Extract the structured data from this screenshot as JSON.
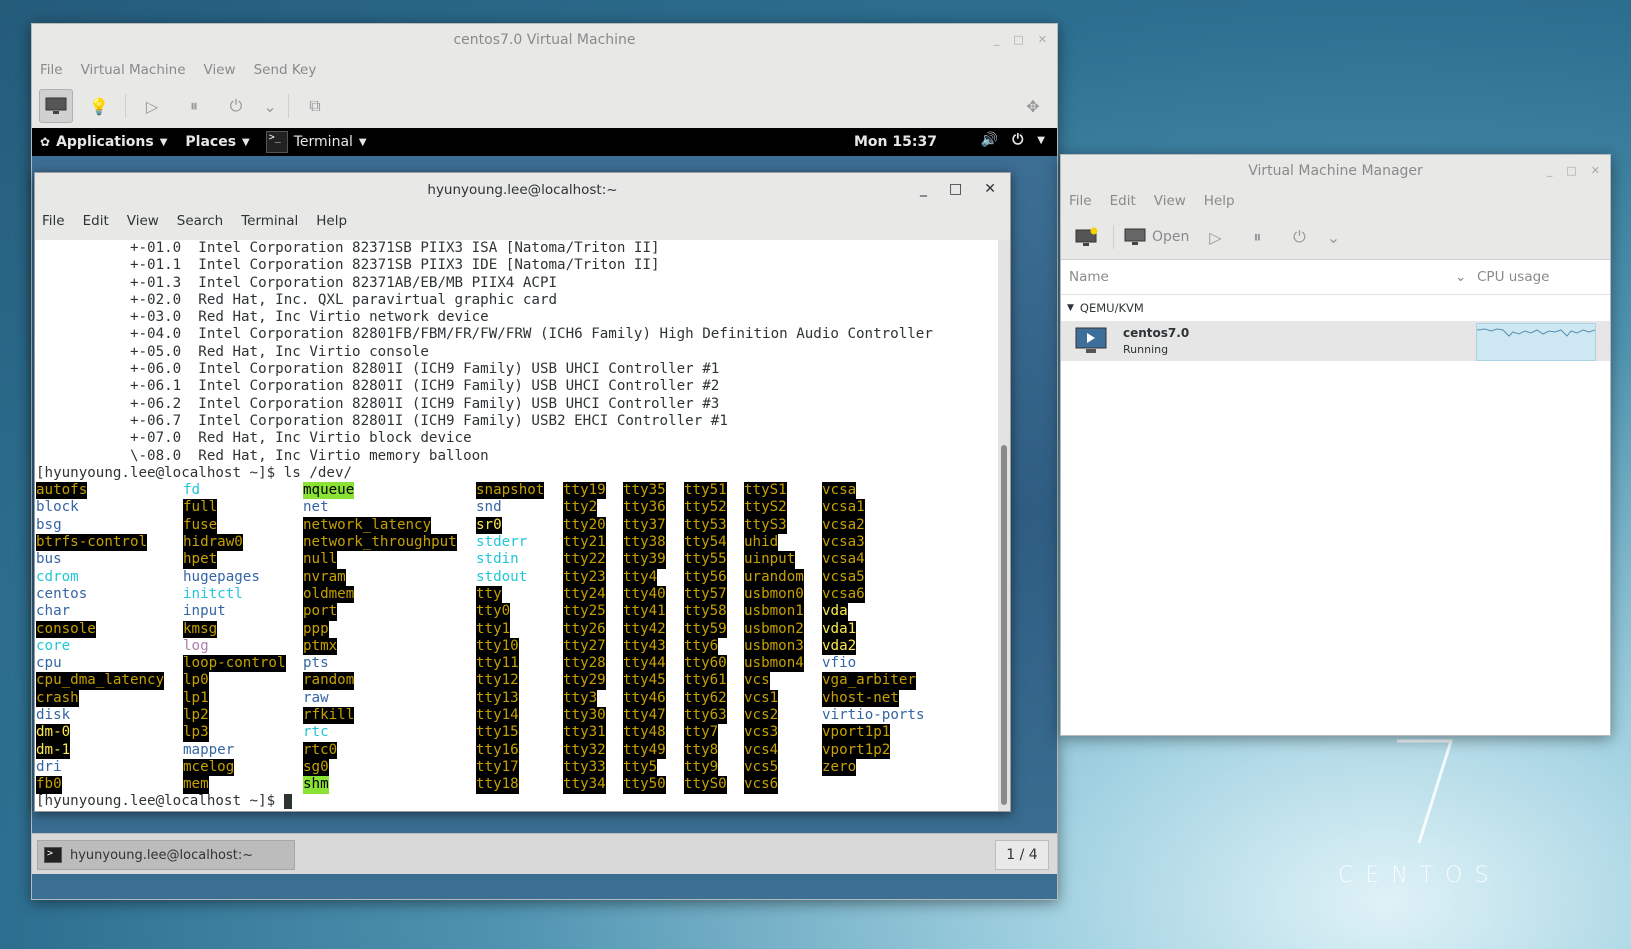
{
  "vm_viewer": {
    "title": "centos7.0 Virtual Machine",
    "menu": [
      "File",
      "Virtual Machine",
      "View",
      "Send Key"
    ]
  },
  "gnome_top_bar": {
    "applications": "Applications",
    "places": "Places",
    "terminal": "Terminal",
    "clock": "Mon 15:37"
  },
  "terminal": {
    "title": "hyunyoung.lee@localhost:~",
    "menu": [
      "File",
      "Edit",
      "View",
      "Search",
      "Terminal",
      "Help"
    ],
    "lines": [
      "           +-01.0  Intel Corporation 82371SB PIIX3 ISA [Natoma/Triton II]",
      "           +-01.1  Intel Corporation 82371SB PIIX3 IDE [Natoma/Triton II]",
      "           +-01.3  Intel Corporation 82371AB/EB/MB PIIX4 ACPI",
      "           +-02.0  Red Hat, Inc. QXL paravirtual graphic card",
      "           +-03.0  Red Hat, Inc Virtio network device",
      "           +-04.0  Intel Corporation 82801FB/FBM/FR/FW/FRW (ICH6 Family) High Definition Audio Controller",
      "           +-05.0  Red Hat, Inc Virtio console",
      "           +-06.0  Intel Corporation 82801I (ICH9 Family) USB UHCI Controller #1",
      "           +-06.1  Intel Corporation 82801I (ICH9 Family) USB UHCI Controller #2",
      "           +-06.2  Intel Corporation 82801I (ICH9 Family) USB UHCI Controller #3",
      "           +-06.7  Intel Corporation 82801I (ICH9 Family) USB2 EHCI Controller #1",
      "           +-07.0  Red Hat, Inc Virtio block device",
      "           \\-08.0  Red Hat, Inc Virtio memory balloon",
      "[hyunyoung.lee@localhost ~]$ ls /dev/"
    ],
    "prompt": "[hyunyoung.lee@localhost ~]$ ",
    "ls_columns": [
      [
        [
          "autofs",
          "dev"
        ],
        [
          "block",
          "dir"
        ],
        [
          "bsg",
          "dir"
        ],
        [
          "btrfs-control",
          "dev"
        ],
        [
          "bus",
          "dir"
        ],
        [
          "cdrom",
          "lnk"
        ],
        [
          "centos",
          "dir"
        ],
        [
          "char",
          "dir"
        ],
        [
          "console",
          "dev"
        ],
        [
          "core",
          "lnk"
        ],
        [
          "cpu",
          "dir"
        ],
        [
          "cpu_dma_latency",
          "dev"
        ],
        [
          "crash",
          "dev"
        ],
        [
          "disk",
          "dir"
        ],
        [
          "dm-0",
          "devy"
        ],
        [
          "dm-1",
          "devy"
        ],
        [
          "dri",
          "dir"
        ],
        [
          "fb0",
          "dev"
        ]
      ],
      [
        [
          "fd",
          "lnk"
        ],
        [
          "full",
          "dev"
        ],
        [
          "fuse",
          "dev"
        ],
        [
          "hidraw0",
          "dev"
        ],
        [
          "hpet",
          "dev"
        ],
        [
          "hugepages",
          "dir"
        ],
        [
          "initctl",
          "lnk"
        ],
        [
          "input",
          "dir"
        ],
        [
          "kmsg",
          "dev"
        ],
        [
          "log",
          "sock"
        ],
        [
          "loop-control",
          "dev"
        ],
        [
          "lp0",
          "dev"
        ],
        [
          "lp1",
          "dev"
        ],
        [
          "lp2",
          "dev"
        ],
        [
          "lp3",
          "dev"
        ],
        [
          "mapper",
          "dir"
        ],
        [
          "mcelog",
          "dev"
        ],
        [
          "mem",
          "dev"
        ]
      ],
      [
        [
          "mqueue",
          "sticky"
        ],
        [
          "net",
          "dir"
        ],
        [
          "network_latency",
          "dev"
        ],
        [
          "network_throughput",
          "dev"
        ],
        [
          "null",
          "dev"
        ],
        [
          "nvram",
          "dev"
        ],
        [
          "oldmem",
          "dev"
        ],
        [
          "port",
          "dev"
        ],
        [
          "ppp",
          "dev"
        ],
        [
          "ptmx",
          "dev"
        ],
        [
          "pts",
          "dir"
        ],
        [
          "random",
          "dev"
        ],
        [
          "raw",
          "dir"
        ],
        [
          "rfkill",
          "dev"
        ],
        [
          "rtc",
          "lnk"
        ],
        [
          "rtc0",
          "dev"
        ],
        [
          "sg0",
          "dev"
        ],
        [
          "shm",
          "sticky"
        ]
      ],
      [
        [
          "snapshot",
          "dev"
        ],
        [
          "snd",
          "dir"
        ],
        [
          "sr0",
          "devy"
        ],
        [
          "stderr",
          "lnk"
        ],
        [
          "stdin",
          "lnk"
        ],
        [
          "stdout",
          "lnk"
        ],
        [
          "tty",
          "dev"
        ],
        [
          "tty0",
          "dev"
        ],
        [
          "tty1",
          "dev"
        ],
        [
          "tty10",
          "dev"
        ],
        [
          "tty11",
          "dev"
        ],
        [
          "tty12",
          "dev"
        ],
        [
          "tty13",
          "dev"
        ],
        [
          "tty14",
          "dev"
        ],
        [
          "tty15",
          "dev"
        ],
        [
          "tty16",
          "dev"
        ],
        [
          "tty17",
          "dev"
        ],
        [
          "tty18",
          "dev"
        ]
      ],
      [
        [
          "tty19",
          "dev"
        ],
        [
          "tty2",
          "dev"
        ],
        [
          "tty20",
          "dev"
        ],
        [
          "tty21",
          "dev"
        ],
        [
          "tty22",
          "dev"
        ],
        [
          "tty23",
          "dev"
        ],
        [
          "tty24",
          "dev"
        ],
        [
          "tty25",
          "dev"
        ],
        [
          "tty26",
          "dev"
        ],
        [
          "tty27",
          "dev"
        ],
        [
          "tty28",
          "dev"
        ],
        [
          "tty29",
          "dev"
        ],
        [
          "tty3",
          "dev"
        ],
        [
          "tty30",
          "dev"
        ],
        [
          "tty31",
          "dev"
        ],
        [
          "tty32",
          "dev"
        ],
        [
          "tty33",
          "dev"
        ],
        [
          "tty34",
          "dev"
        ]
      ],
      [
        [
          "tty35",
          "dev"
        ],
        [
          "tty36",
          "dev"
        ],
        [
          "tty37",
          "dev"
        ],
        [
          "tty38",
          "dev"
        ],
        [
          "tty39",
          "dev"
        ],
        [
          "tty4",
          "dev"
        ],
        [
          "tty40",
          "dev"
        ],
        [
          "tty41",
          "dev"
        ],
        [
          "tty42",
          "dev"
        ],
        [
          "tty43",
          "dev"
        ],
        [
          "tty44",
          "dev"
        ],
        [
          "tty45",
          "dev"
        ],
        [
          "tty46",
          "dev"
        ],
        [
          "tty47",
          "dev"
        ],
        [
          "tty48",
          "dev"
        ],
        [
          "tty49",
          "dev"
        ],
        [
          "tty5",
          "dev"
        ],
        [
          "tty50",
          "dev"
        ]
      ],
      [
        [
          "tty51",
          "dev"
        ],
        [
          "tty52",
          "dev"
        ],
        [
          "tty53",
          "dev"
        ],
        [
          "tty54",
          "dev"
        ],
        [
          "tty55",
          "dev"
        ],
        [
          "tty56",
          "dev"
        ],
        [
          "tty57",
          "dev"
        ],
        [
          "tty58",
          "dev"
        ],
        [
          "tty59",
          "dev"
        ],
        [
          "tty6",
          "dev"
        ],
        [
          "tty60",
          "dev"
        ],
        [
          "tty61",
          "dev"
        ],
        [
          "tty62",
          "dev"
        ],
        [
          "tty63",
          "dev"
        ],
        [
          "tty7",
          "dev"
        ],
        [
          "tty8",
          "dev"
        ],
        [
          "tty9",
          "dev"
        ],
        [
          "ttyS0",
          "dev"
        ]
      ],
      [
        [
          "ttyS1",
          "dev"
        ],
        [
          "ttyS2",
          "dev"
        ],
        [
          "ttyS3",
          "dev"
        ],
        [
          "uhid",
          "dev"
        ],
        [
          "uinput",
          "dev"
        ],
        [
          "urandom",
          "dev"
        ],
        [
          "usbmon0",
          "dev"
        ],
        [
          "usbmon1",
          "dev"
        ],
        [
          "usbmon2",
          "dev"
        ],
        [
          "usbmon3",
          "dev"
        ],
        [
          "usbmon4",
          "dev"
        ],
        [
          "vcs",
          "dev"
        ],
        [
          "vcs1",
          "dev"
        ],
        [
          "vcs2",
          "dev"
        ],
        [
          "vcs3",
          "dev"
        ],
        [
          "vcs4",
          "dev"
        ],
        [
          "vcs5",
          "dev"
        ],
        [
          "vcs6",
          "dev"
        ]
      ],
      [
        [
          "vcsa",
          "dev"
        ],
        [
          "vcsa1",
          "dev"
        ],
        [
          "vcsa2",
          "dev"
        ],
        [
          "vcsa3",
          "dev"
        ],
        [
          "vcsa4",
          "dev"
        ],
        [
          "vcsa5",
          "dev"
        ],
        [
          "vcsa6",
          "dev"
        ],
        [
          "vda",
          "devy"
        ],
        [
          "vda1",
          "devy"
        ],
        [
          "vda2",
          "devy"
        ],
        [
          "vfio",
          "dir"
        ],
        [
          "vga_arbiter",
          "dev"
        ],
        [
          "vhost-net",
          "dev"
        ],
        [
          "virtio-ports",
          "dir"
        ],
        [
          "vport1p1",
          "dev"
        ],
        [
          "vport1p2",
          "dev"
        ],
        [
          "zero",
          "dev"
        ]
      ]
    ]
  },
  "taskbar": {
    "task_label": "hyunyoung.lee@localhost:~",
    "pager": "1 / 4"
  },
  "vmm": {
    "title": "Virtual Machine Manager",
    "menu": [
      "File",
      "Edit",
      "View",
      "Help"
    ],
    "open_label": "Open",
    "col_name": "Name",
    "col_cpu": "CPU usage",
    "group": "QEMU/KVM",
    "vm_name": "centos7.0",
    "vm_status": "Running"
  },
  "desktop": {
    "logo_word": "CENTOS"
  },
  "colors": {
    "dir": "#3465a4",
    "link": "#22c6d6",
    "device_fg": "#c4a000",
    "device_bg": "#000000",
    "sticky_bg": "#8ae234"
  }
}
